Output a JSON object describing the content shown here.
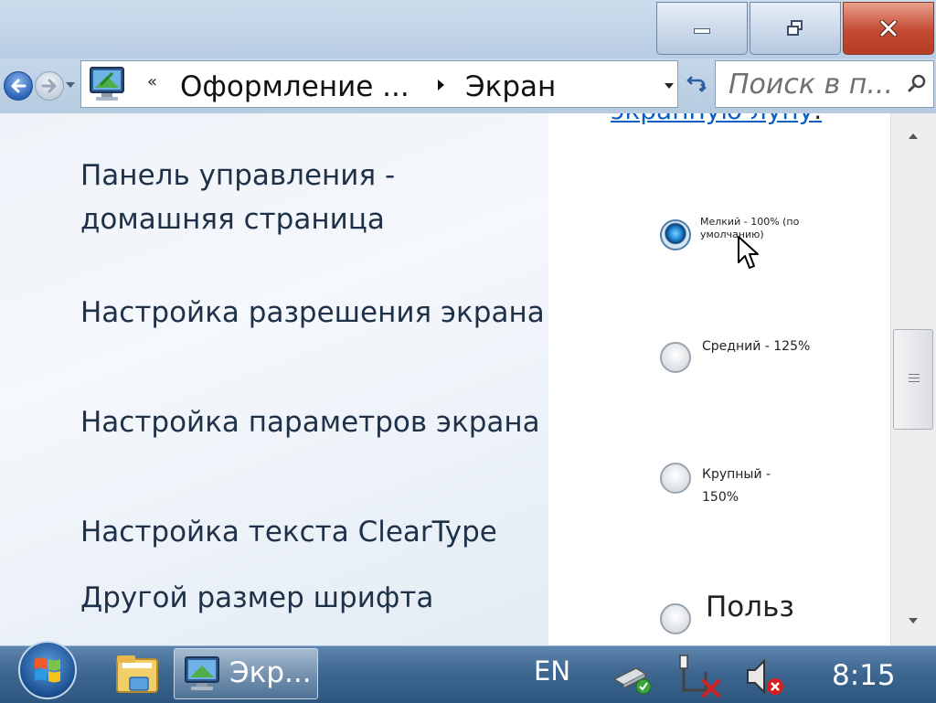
{
  "window": {
    "minimize_icon": "minimize-icon",
    "maximize_icon": "restore-icon",
    "close_icon": "close-icon"
  },
  "navigation": {
    "back_icon": "back-arrow-icon",
    "forward_icon": "forward-arrow-icon"
  },
  "address_bar": {
    "overflow_chevron": "«",
    "crumbs": [
      "Оформление ...",
      "Экран"
    ],
    "refresh_icon": "refresh-icon"
  },
  "search": {
    "placeholder": "Поиск в п..."
  },
  "sidebar": {
    "links": [
      "Панель управления - домашняя страница",
      "Настройка разрешения экрана",
      "Настройка параметров экрана",
      "Настройка текста ClearType",
      "Другой размер шрифта"
    ]
  },
  "main": {
    "magnifier_link": "экранную лупу",
    "magnifier_link_suffix": ".",
    "options": [
      {
        "label": "Мелкий - 100% (по умолчанию)",
        "checked": true
      },
      {
        "label": "Средний - 125%",
        "checked": false
      },
      {
        "label": "Крупный - 150%",
        "checked": false
      },
      {
        "label": "Польз",
        "checked": false
      }
    ]
  },
  "taskbar": {
    "active_window_label": "Экр...",
    "language": "EN",
    "clock": "8:15"
  },
  "colors": {
    "link": "#0a5ec2",
    "close_button": "#c24a31",
    "taskbar": "#3e6791"
  }
}
